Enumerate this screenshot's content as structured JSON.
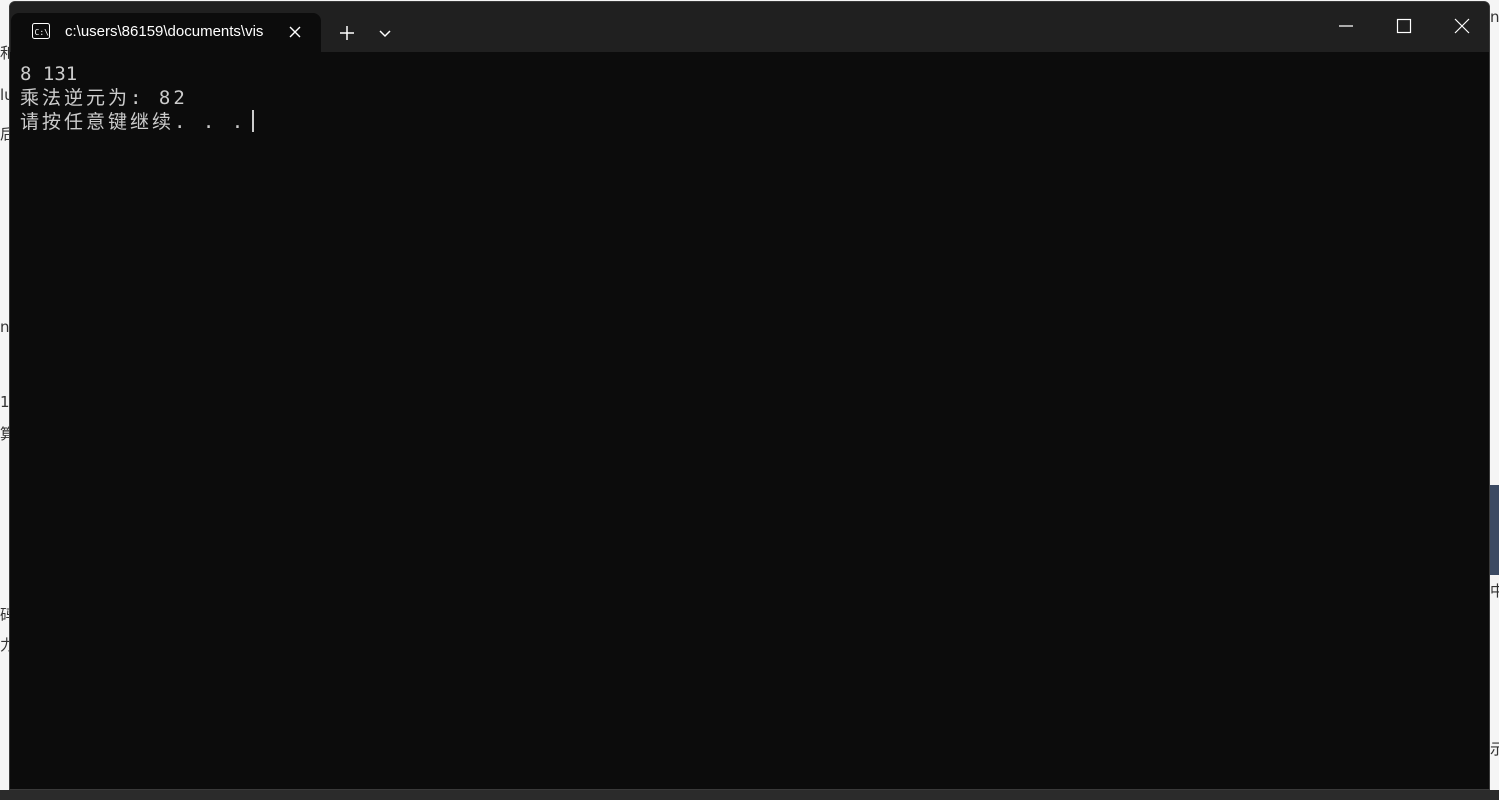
{
  "window": {
    "tab_title": "c:\\users\\86159\\documents\\vis",
    "tab_icon": "cmd-icon"
  },
  "console": {
    "lines": [
      "8 131",
      "乘法逆元为: 82",
      "请按任意键继续. . ."
    ]
  },
  "colors": {
    "terminal_background": "#0c0c0c",
    "title_bar": "#202020",
    "console_text": "#cccccc"
  }
}
